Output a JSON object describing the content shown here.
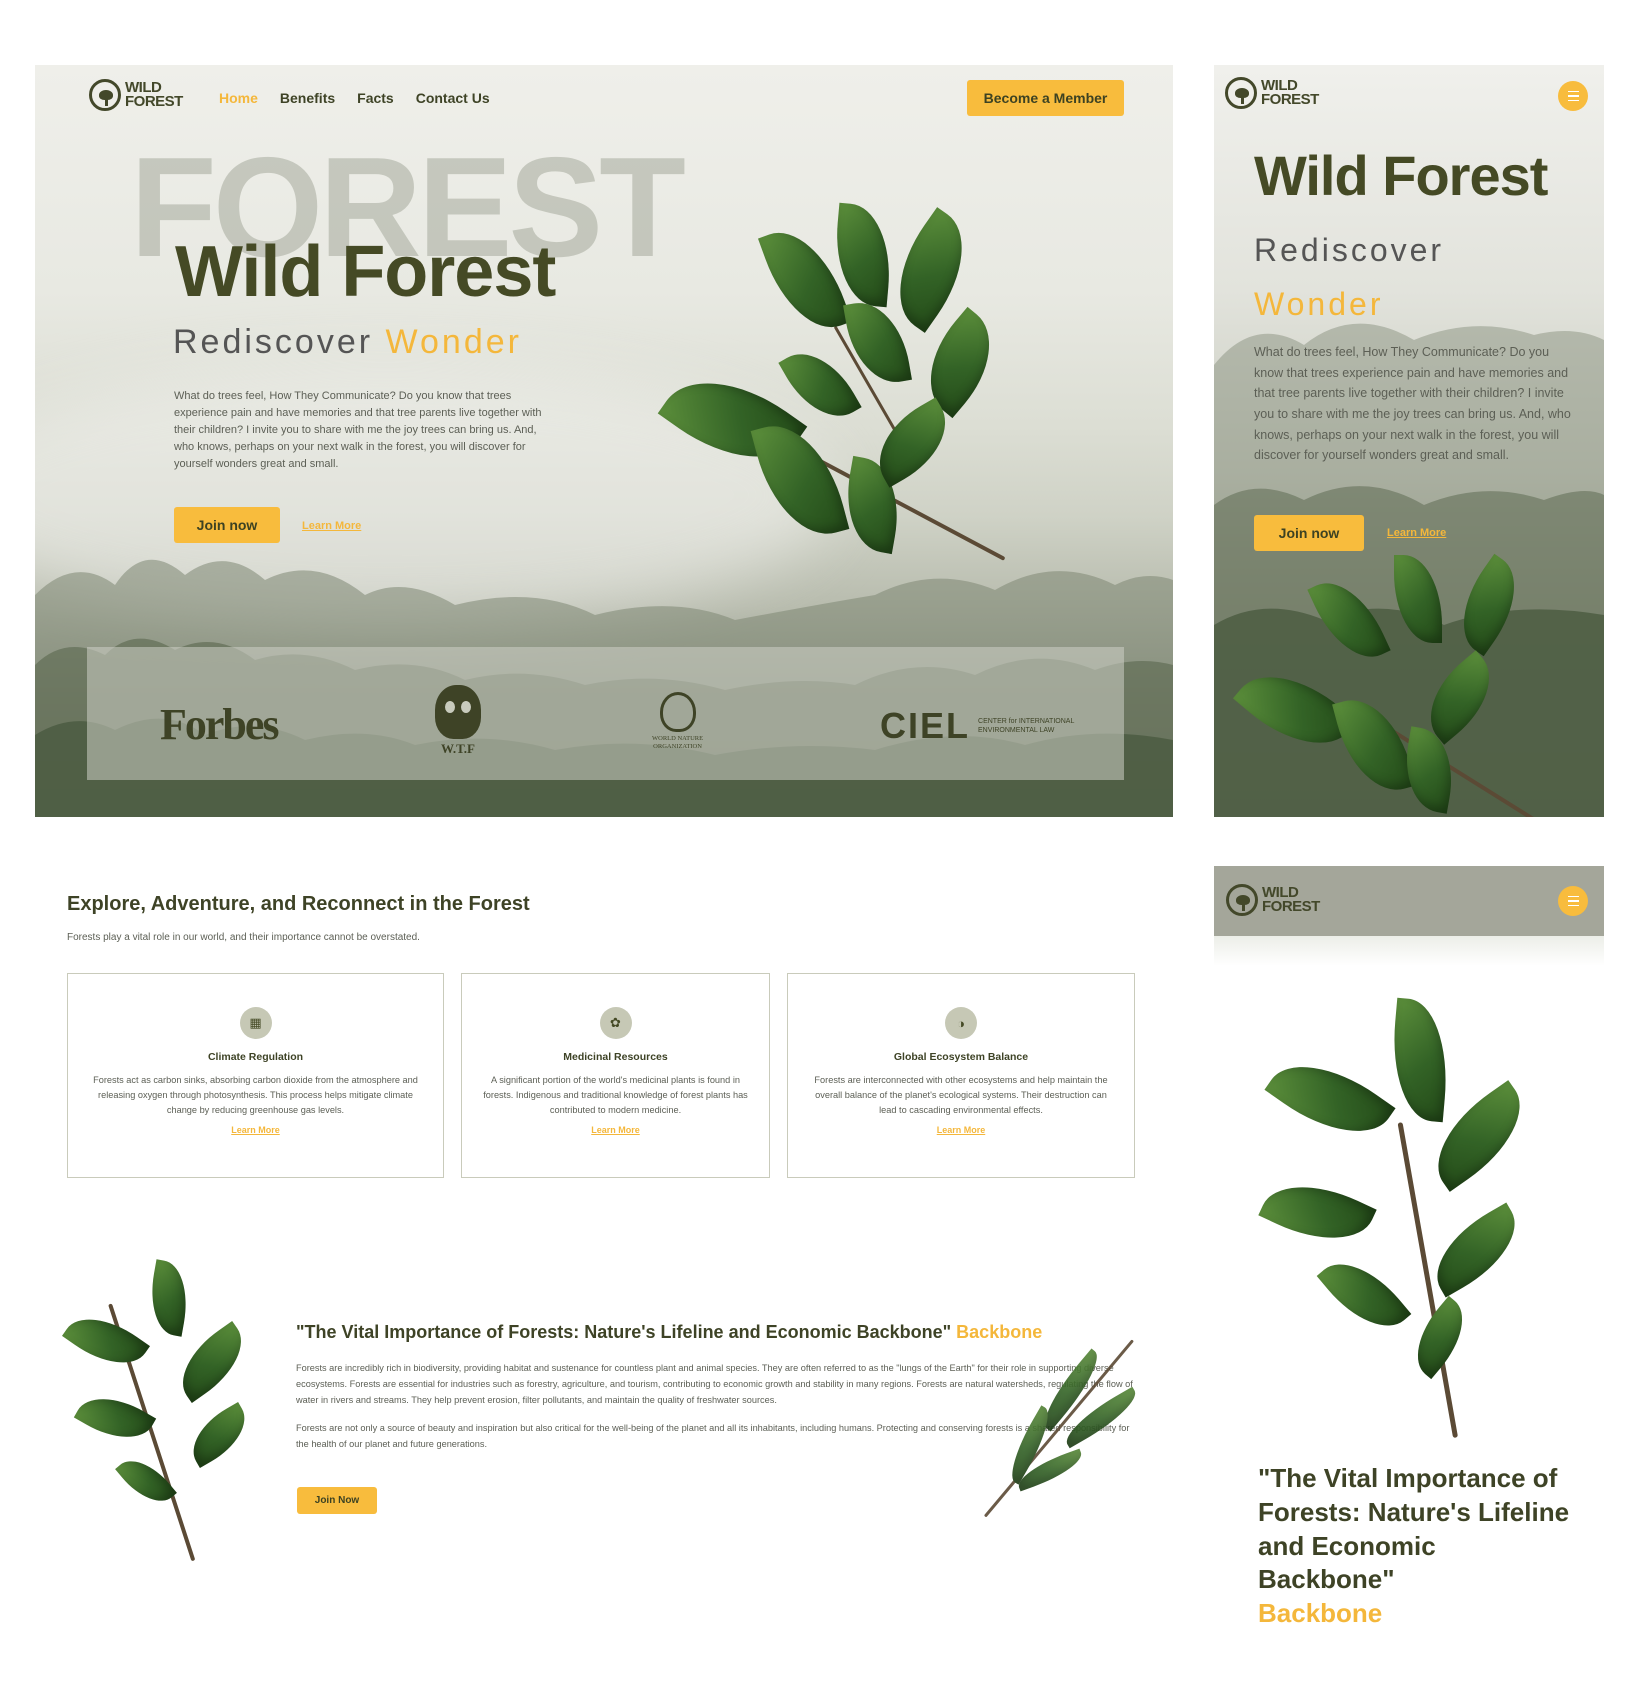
{
  "brand": {
    "line1": "WILD",
    "line2": "FOREST"
  },
  "nav": {
    "home": "Home",
    "benefits": "Benefits",
    "facts": "Facts",
    "contact": "Contact Us"
  },
  "cta": {
    "member": "Become a Member",
    "join": "Join now",
    "learn": "Learn More"
  },
  "hero": {
    "ghost": "FOREST",
    "title": "Wild Forest",
    "sub_prefix": "Rediscover",
    "sub_accent": "Wonder",
    "paragraph": "What do trees feel, How They Communicate? Do you know that trees experience pain and have memories and that tree parents live together with their children? I invite you to share with me the joy trees can bring us. And, who knows, perhaps on your next walk in the forest, you will discover for yourself wonders great and small."
  },
  "logos": {
    "forbes": "Forbes",
    "wtf": "W.T.F",
    "wno_line1": "WORLD NATURE",
    "wno_line2": "ORGANIZATION",
    "ciel": "CIEL",
    "ciel_line1": "CENTER for INTERNATIONAL",
    "ciel_line2": "ENVIRONMENTAL LAW"
  },
  "explore": {
    "title": "Explore, Adventure, and Reconnect in the Forest",
    "subtitle": "Forests play a vital role in our world, and their importance cannot be overstated.",
    "cards": [
      {
        "title": "Climate Regulation",
        "text": "Forests act as carbon sinks, absorbing carbon dioxide from the atmosphere and releasing oxygen through photosynthesis. This process helps mitigate climate change by reducing greenhouse gas levels.",
        "link": "Learn More",
        "icon": "building-icon"
      },
      {
        "title": "Medicinal Resources",
        "text": "A significant portion of the world's medicinal plants is found in forests. Indigenous and traditional knowledge of forest plants has contributed to modern medicine.",
        "link": "Learn More",
        "icon": "paw-icon"
      },
      {
        "title": "Global Ecosystem Balance",
        "text": "Forests are interconnected with other ecosystems and help maintain the overall balance of the planet's ecological systems. Their destruction can lead to cascading environmental effects.",
        "link": "Learn More",
        "icon": "globe-icon"
      }
    ]
  },
  "vital": {
    "title": "\"The Vital Importance of Forests: Nature's Lifeline and Economic Backbone\"",
    "accent": "Backbone",
    "p1": "Forests are incredibly rich in biodiversity, providing habitat and sustenance for countless plant and animal species. They are often referred to as the \"lungs of the Earth\" for their role in supporting diverse ecosystems. Forests are essential for industries such as forestry, agriculture, and tourism, contributing to economic growth and stability in many regions. Forests are natural watersheds, regulating the flow of water in rivers and streams. They help prevent erosion, filter pollutants, and maintain the quality of freshwater sources.",
    "p2": "Forests are not only a source of beauty and inspiration but also critical for the well-being of the planet and all its inhabitants, including humans. Protecting and conserving forests is a shared responsibility for the health of our planet and future generations.",
    "button": "Join Now"
  },
  "colors": {
    "accent": "#f8bc3d",
    "olive": "#454a25",
    "mist": "#e8e9e2"
  }
}
